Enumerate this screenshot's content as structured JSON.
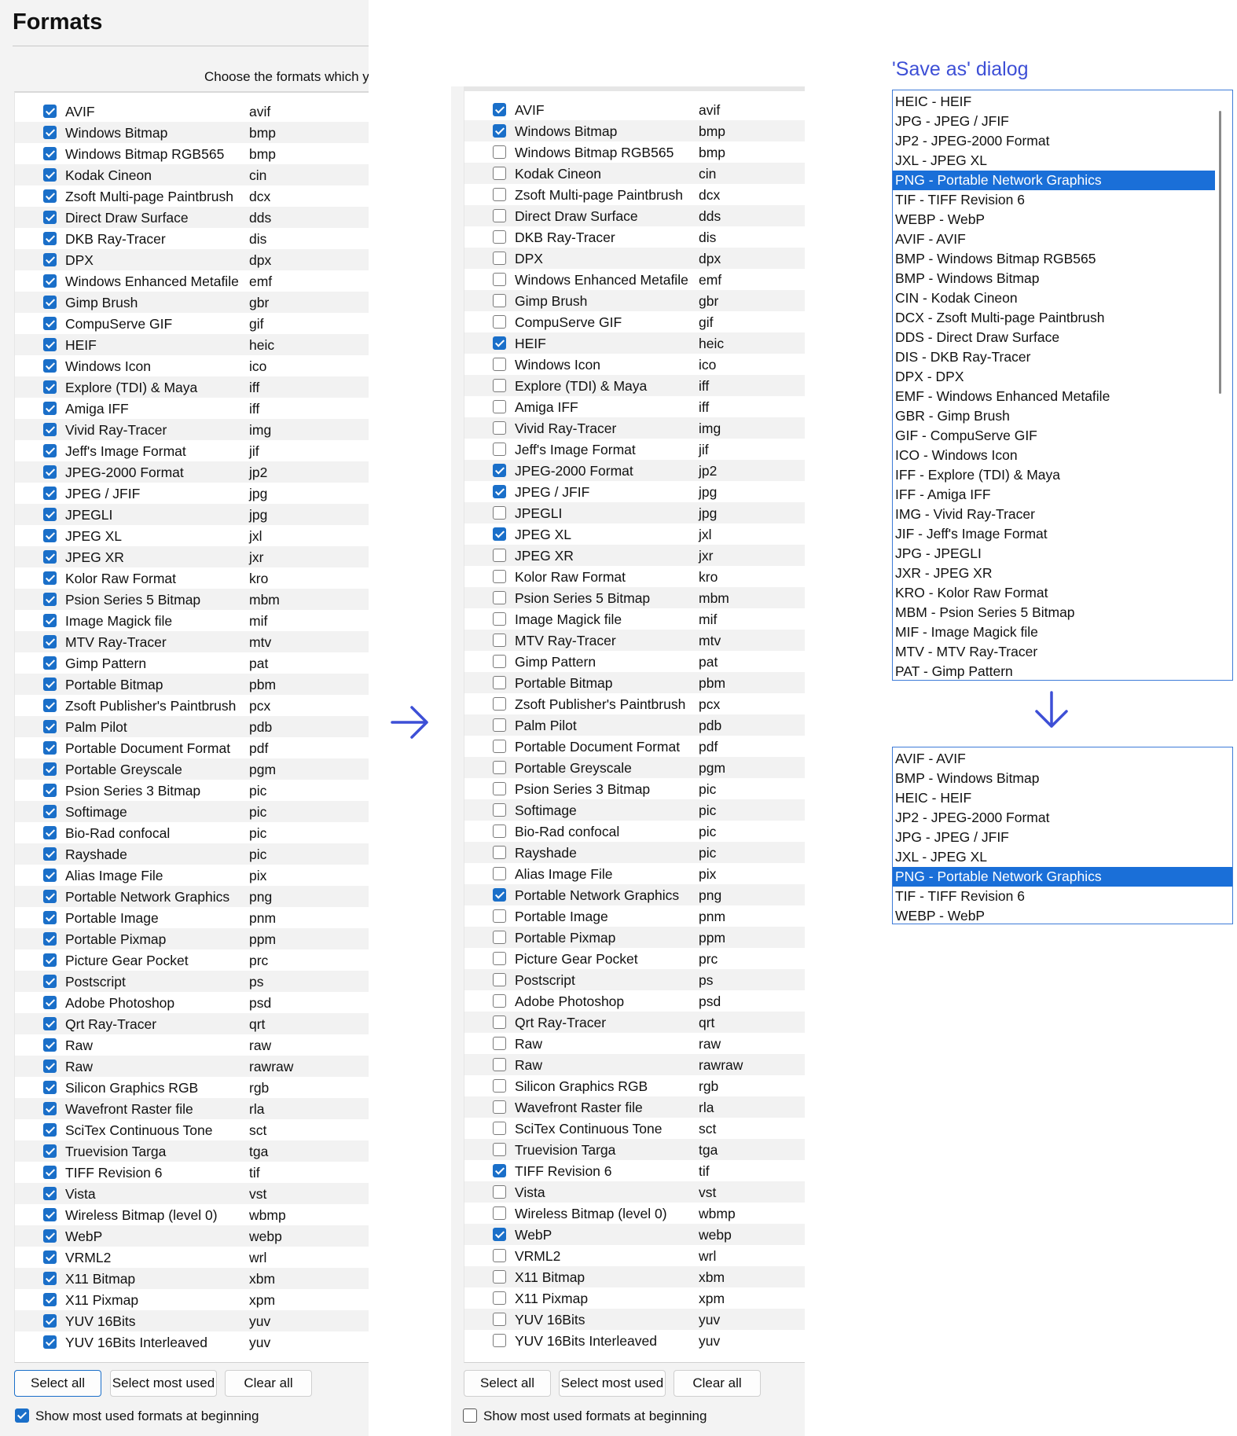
{
  "left_panel": {
    "title": "Formats",
    "subtitle": "Choose the formats which yo",
    "buttons": {
      "select_all": "Select all",
      "select_most_used": "Select most used",
      "clear_all": "Clear all"
    },
    "footer_checkbox_label": "Show most used formats at beginning",
    "footer_checked": true
  },
  "mid_panel": {
    "buttons": {
      "select_all": "Select all",
      "select_most_used": "Select most used",
      "clear_all": "Clear all"
    },
    "footer_checkbox_label": "Show most used formats at beginning",
    "footer_checked": false
  },
  "formats": [
    {
      "name": "AVIF",
      "ext": "avif",
      "most_used": true
    },
    {
      "name": "Windows Bitmap",
      "ext": "bmp",
      "most_used": true
    },
    {
      "name": "Windows Bitmap RGB565",
      "ext": "bmp",
      "most_used": false
    },
    {
      "name": "Kodak Cineon",
      "ext": "cin",
      "most_used": false
    },
    {
      "name": "Zsoft Multi-page Paintbrush",
      "ext": "dcx",
      "most_used": false
    },
    {
      "name": "Direct Draw Surface",
      "ext": "dds",
      "most_used": false
    },
    {
      "name": "DKB Ray-Tracer",
      "ext": "dis",
      "most_used": false
    },
    {
      "name": "DPX",
      "ext": "dpx",
      "most_used": false
    },
    {
      "name": "Windows Enhanced Metafile",
      "ext": "emf",
      "most_used": false
    },
    {
      "name": "Gimp Brush",
      "ext": "gbr",
      "most_used": false
    },
    {
      "name": "CompuServe GIF",
      "ext": "gif",
      "most_used": false
    },
    {
      "name": "HEIF",
      "ext": "heic",
      "most_used": true
    },
    {
      "name": "Windows Icon",
      "ext": "ico",
      "most_used": false
    },
    {
      "name": "Explore (TDI) & Maya",
      "ext": "iff",
      "most_used": false
    },
    {
      "name": "Amiga IFF",
      "ext": "iff",
      "most_used": false
    },
    {
      "name": "Vivid Ray-Tracer",
      "ext": "img",
      "most_used": false
    },
    {
      "name": "Jeff's Image Format",
      "ext": "jif",
      "most_used": false
    },
    {
      "name": "JPEG-2000 Format",
      "ext": "jp2",
      "most_used": true
    },
    {
      "name": "JPEG / JFIF",
      "ext": "jpg",
      "most_used": true
    },
    {
      "name": "JPEGLI",
      "ext": "jpg",
      "most_used": false
    },
    {
      "name": "JPEG XL",
      "ext": "jxl",
      "most_used": true
    },
    {
      "name": "JPEG XR",
      "ext": "jxr",
      "most_used": false
    },
    {
      "name": "Kolor Raw Format",
      "ext": "kro",
      "most_used": false
    },
    {
      "name": "Psion Series 5 Bitmap",
      "ext": "mbm",
      "most_used": false
    },
    {
      "name": "Image Magick file",
      "ext": "mif",
      "most_used": false
    },
    {
      "name": "MTV Ray-Tracer",
      "ext": "mtv",
      "most_used": false
    },
    {
      "name": "Gimp Pattern",
      "ext": "pat",
      "most_used": false
    },
    {
      "name": "Portable Bitmap",
      "ext": "pbm",
      "most_used": false
    },
    {
      "name": "Zsoft Publisher's Paintbrush",
      "ext": "pcx",
      "most_used": false
    },
    {
      "name": "Palm Pilot",
      "ext": "pdb",
      "most_used": false
    },
    {
      "name": "Portable Document Format",
      "ext": "pdf",
      "most_used": false
    },
    {
      "name": "Portable Greyscale",
      "ext": "pgm",
      "most_used": false
    },
    {
      "name": "Psion Series 3 Bitmap",
      "ext": "pic",
      "most_used": false
    },
    {
      "name": "Softimage",
      "ext": "pic",
      "most_used": false
    },
    {
      "name": "Bio-Rad confocal",
      "ext": "pic",
      "most_used": false
    },
    {
      "name": "Rayshade",
      "ext": "pic",
      "most_used": false
    },
    {
      "name": "Alias Image File",
      "ext": "pix",
      "most_used": false
    },
    {
      "name": "Portable Network Graphics",
      "ext": "png",
      "most_used": true
    },
    {
      "name": "Portable Image",
      "ext": "pnm",
      "most_used": false
    },
    {
      "name": "Portable Pixmap",
      "ext": "ppm",
      "most_used": false
    },
    {
      "name": "Picture Gear Pocket",
      "ext": "prc",
      "most_used": false
    },
    {
      "name": "Postscript",
      "ext": "ps",
      "most_used": false
    },
    {
      "name": "Adobe Photoshop",
      "ext": "psd",
      "most_used": false
    },
    {
      "name": "Qrt Ray-Tracer",
      "ext": "qrt",
      "most_used": false
    },
    {
      "name": "Raw",
      "ext": "raw",
      "most_used": false
    },
    {
      "name": "Raw",
      "ext": "rawraw",
      "most_used": false
    },
    {
      "name": "Silicon Graphics RGB",
      "ext": "rgb",
      "most_used": false
    },
    {
      "name": "Wavefront Raster file",
      "ext": "rla",
      "most_used": false
    },
    {
      "name": "SciTex Continuous Tone",
      "ext": "sct",
      "most_used": false
    },
    {
      "name": "Truevision Targa",
      "ext": "tga",
      "most_used": false
    },
    {
      "name": "TIFF Revision 6",
      "ext": "tif",
      "most_used": true
    },
    {
      "name": "Vista",
      "ext": "vst",
      "most_used": false
    },
    {
      "name": "Wireless Bitmap (level 0)",
      "ext": "wbmp",
      "most_used": false
    },
    {
      "name": "WebP",
      "ext": "webp",
      "most_used": true
    },
    {
      "name": "VRML2",
      "ext": "wrl",
      "most_used": false
    },
    {
      "name": "X11 Bitmap",
      "ext": "xbm",
      "most_used": false
    },
    {
      "name": "X11 Pixmap",
      "ext": "xpm",
      "most_used": false
    },
    {
      "name": "YUV 16Bits",
      "ext": "yuv",
      "most_used": false
    },
    {
      "name": "YUV 16Bits Interleaved",
      "ext": "yuv",
      "most_used": false
    }
  ],
  "save_dialog": {
    "heading": "'Save as' dialog",
    "top_items": [
      "HEIC - HEIF",
      "JPG - JPEG / JFIF",
      "JP2 - JPEG-2000 Format",
      "JXL - JPEG XL",
      "PNG - Portable Network Graphics",
      "TIF - TIFF Revision 6",
      "WEBP - WebP",
      "AVIF - AVIF",
      "BMP - Windows Bitmap RGB565",
      "BMP - Windows Bitmap",
      "CIN - Kodak Cineon",
      "DCX - Zsoft Multi-page Paintbrush",
      "DDS - Direct Draw Surface",
      "DIS - DKB Ray-Tracer",
      "DPX - DPX",
      "EMF - Windows Enhanced Metafile",
      "GBR - Gimp Brush",
      "GIF - CompuServe GIF",
      "ICO - Windows Icon",
      "IFF - Explore (TDI) & Maya",
      "IFF - Amiga IFF",
      "IMG - Vivid Ray-Tracer",
      "JIF - Jeff's Image Format",
      "JPG - JPEGLI",
      "JXR - JPEG XR",
      "KRO - Kolor Raw Format",
      "MBM - Psion Series 5 Bitmap",
      "MIF - Image Magick file",
      "MTV - MTV Ray-Tracer",
      "PAT - Gimp Pattern"
    ],
    "top_selected_index": 4,
    "bottom_items": [
      "AVIF - AVIF",
      "BMP - Windows Bitmap",
      "HEIC - HEIF",
      "JP2 - JPEG-2000 Format",
      "JPG - JPEG / JFIF",
      "JXL - JPEG XL",
      "PNG - Portable Network Graphics",
      "TIF - TIFF Revision 6",
      "WEBP - WebP"
    ],
    "bottom_selected_index": 6
  },
  "colors": {
    "accent": "#1a6fc9",
    "arrow": "#3d4fd6",
    "selection": "#1a6fd8"
  },
  "icons": {
    "transition_arrow_right": "arrow-right-icon",
    "transition_arrow_down": "arrow-down-icon"
  }
}
